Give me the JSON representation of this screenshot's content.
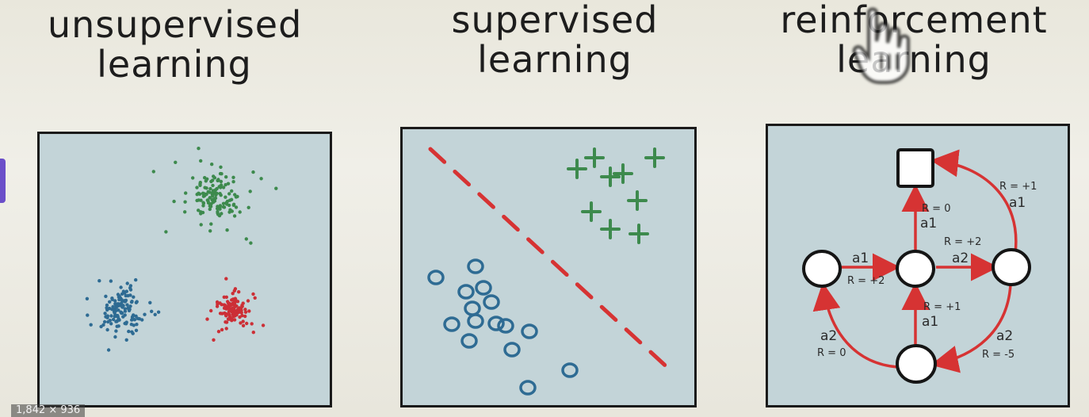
{
  "titles": {
    "unsupervised": [
      "unsupervised",
      "learning"
    ],
    "supervised": [
      "supervised",
      "learning"
    ],
    "reinforcement": [
      "reinforcement",
      "learning"
    ]
  },
  "colors": {
    "panel_bg": "#c3d4d8",
    "green": "#3d8a4d",
    "blue": "#2e6b93",
    "red": "#cc2f36",
    "edge": "#d63333"
  },
  "rl_edges": {
    "top_right": [
      "R = +1",
      "a1"
    ],
    "mid_up": [
      "R = 0",
      "a1"
    ],
    "mid_right": [
      "R = +2",
      "a2"
    ],
    "left_mid": [
      "a1",
      "R = +2"
    ],
    "bottom_up": [
      "R = +1",
      "a1"
    ],
    "left_bottom": [
      "a2",
      "R = 0"
    ],
    "right_bottom": [
      "a2",
      "R = -5"
    ]
  },
  "image_size_badge": "1,842 × 936"
}
